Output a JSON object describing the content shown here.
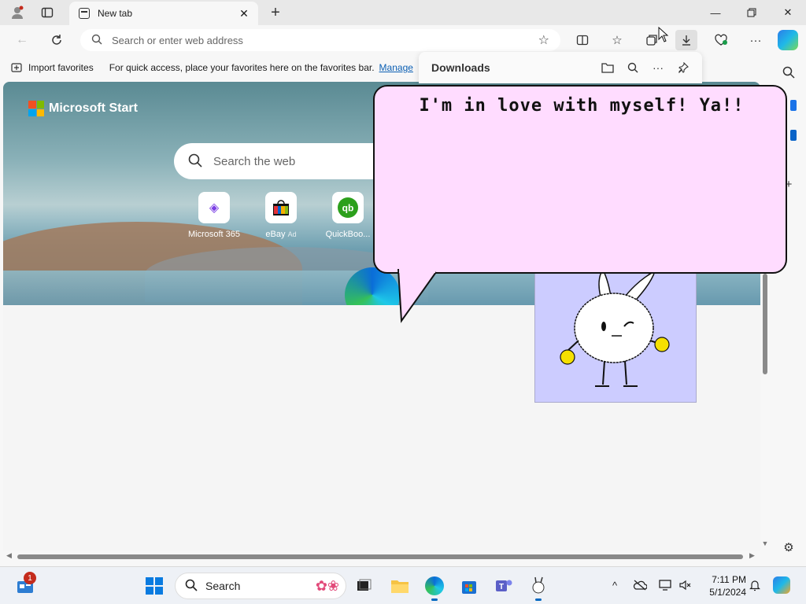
{
  "browser": {
    "tab_title": "New tab",
    "address_placeholder": "Search or enter web address"
  },
  "favorites_bar": {
    "import_label": "Import favorites",
    "hint": "For quick access, place your favorites here on the favorites bar.",
    "manage_link": "Manage"
  },
  "newtab": {
    "brand": "Microsoft Start",
    "search_placeholder": "Search the web",
    "quick_links": [
      {
        "label": "Microsoft 365",
        "icon": "microsoft-365-icon"
      },
      {
        "label": "eBay",
        "ad": "Ad",
        "icon": "ebay-icon"
      },
      {
        "label": "QuickBoo...",
        "icon": "quickbooks-icon"
      }
    ]
  },
  "downloads": {
    "title": "Downloads"
  },
  "bubble": {
    "text": "I'm in love with myself! Ya!!"
  },
  "taskbar": {
    "search_label": "Search",
    "notification_count": "1",
    "time": "7:11 PM",
    "date": "5/1/2024"
  },
  "colors": {
    "bubble_fill": "#ffdcff",
    "character_window": "#ccccff",
    "accent": "#0067c0"
  }
}
